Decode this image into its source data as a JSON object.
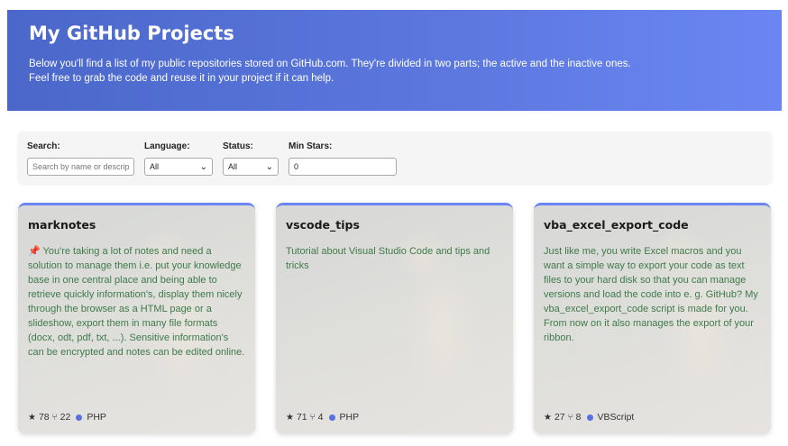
{
  "header": {
    "title": "My GitHub Projects",
    "line1": "Below you'll find a list of my public repositories stored on GitHub.com. They're divided in two parts; the active and the inactive ones.",
    "line2": "Feel free to grab the code and reuse it in your project if it can help."
  },
  "filters": {
    "search_label": "Search:",
    "search_placeholder": "Search by name or description",
    "language_label": "Language:",
    "language_value": "All",
    "status_label": "Status:",
    "status_value": "All",
    "minstars_label": "Min Stars:",
    "minstars_value": "0"
  },
  "cards": [
    {
      "name": "marknotes",
      "description": "📌 You're taking a lot of notes and need a solution to manage them i.e. put your knowledge base in one central place and being able to retrieve quickly information's, display them nicely through the browser as a HTML page or a slideshow, export them in many file formats (docx, odt, pdf, txt, ...). Sensitive information's can be encrypted and notes can be edited online.",
      "stars": "78",
      "forks": "22",
      "language": "PHP"
    },
    {
      "name": "vscode_tips",
      "description": "Tutorial about Visual Studio Code and tips and tricks",
      "stars": "71",
      "forks": "4",
      "language": "PHP"
    },
    {
      "name": "vba_excel_export_code",
      "description": "Just like me, you write Excel macros and you want a simple way to export your code as text files to your hard disk so that you can manage versions and load the code into e. g. GitHub? My vba_excel_export_code script is made for you. From now on it also manages the export of your ribbon.",
      "stars": "27",
      "forks": "8",
      "language": "VBScript"
    }
  ],
  "colors": {
    "header_start": "#4a67c9",
    "header_end": "#6b86f2",
    "description_text": "#3f7a4a",
    "language_dot": "#5a6fe0"
  }
}
